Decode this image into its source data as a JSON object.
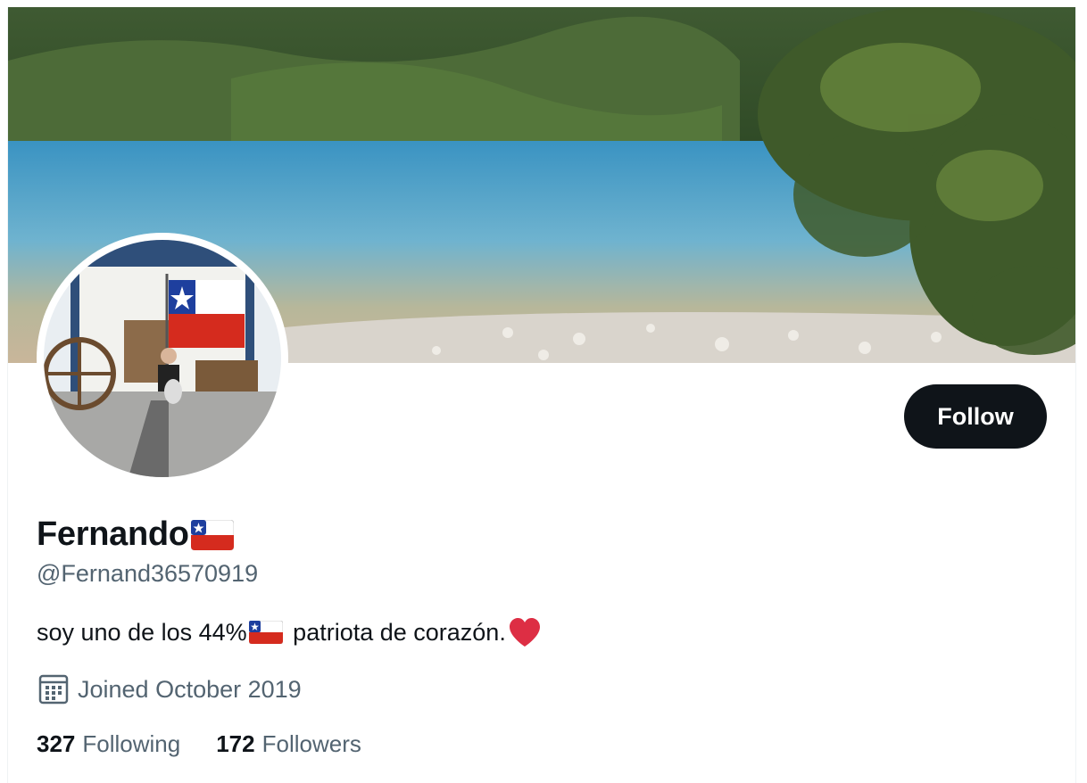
{
  "profile": {
    "display_name": "Fernando",
    "handle": "@Fernand36570919",
    "bio_before": "soy uno de los 44%",
    "bio_after": " patriota de corazón.",
    "joined": "Joined October 2019",
    "follow_label": "Follow"
  },
  "stats": {
    "following_count": "327",
    "following_label": "Following",
    "followers_count": "172",
    "followers_label": "Followers"
  },
  "icons": {
    "name_flag": "chile-flag-icon",
    "bio_flag": "chile-flag-icon",
    "heart": "red-heart-icon",
    "calendar": "calendar-icon"
  },
  "colors": {
    "primary_text": "#0f1419",
    "secondary_text": "#536471",
    "follow_button": "#0f1419"
  }
}
